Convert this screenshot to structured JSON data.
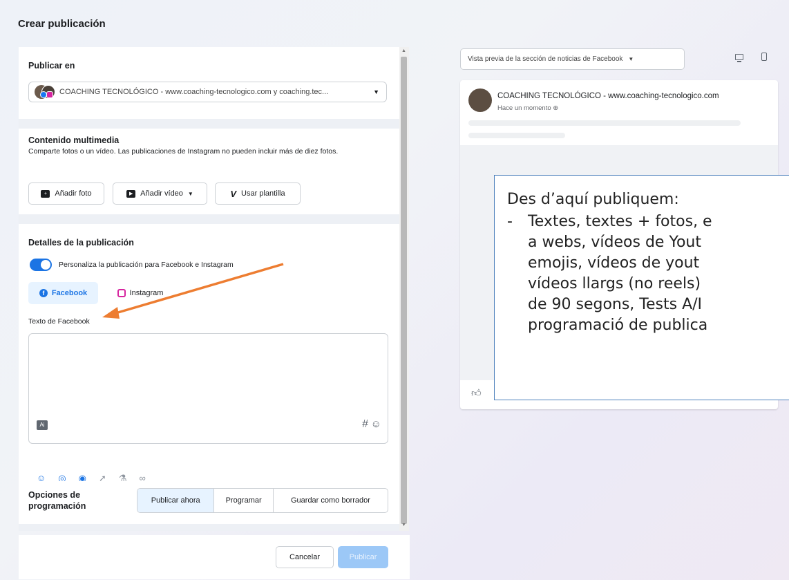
{
  "page": {
    "title": "Crear publicación"
  },
  "publish_in": {
    "title": "Publicar en",
    "selected_page": "COACHING TECNOLÓGICO - www.coaching-tecnologico.com y coaching.tec..."
  },
  "media": {
    "title": "Contenido multimedia",
    "description": "Comparte fotos o un vídeo. Las publicaciones de Instagram no pueden incluir más de diez fotos.",
    "add_photo": "Añadir foto",
    "add_video": "Añadir vídeo",
    "use_template": "Usar plantilla"
  },
  "details": {
    "title": "Detalles de la publicación",
    "toggle_label": "Personaliza la publicación para Facebook e Instagram",
    "toggle_on": true,
    "tabs": [
      {
        "label": "Facebook",
        "active": true
      },
      {
        "label": "Instagram",
        "active": false
      }
    ],
    "text_label": "Texto de Facebook",
    "text_value": "",
    "hash_symbol": "#"
  },
  "scheduling": {
    "title": "Opciones de programación",
    "options": [
      {
        "label": "Publicar ahora",
        "active": true
      },
      {
        "label": "Programar",
        "active": false
      },
      {
        "label": "Guardar como borrador",
        "active": false
      }
    ]
  },
  "footer": {
    "cancel": "Cancelar",
    "publish": "Publicar"
  },
  "preview": {
    "selector": "Vista previa de la sección de noticias de Facebook",
    "page_name": "COACHING TECNOLÓGICO - www.coaching-tecnologico.com",
    "timestamp": "Hace un momento"
  },
  "callout": {
    "line1": "Des d’aquí publiquem:",
    "list_lines": [
      "Textes, textes + fotos, e",
      "a webs, vídeos de Yout",
      "emojis, vídeos de yout",
      "vídeos llargs (no reels)",
      "de 90 segons, Tests A/I",
      "programació de publica"
    ]
  },
  "colors": {
    "accent": "#1b74e4",
    "arrow": "#ed7d31",
    "callout_border": "#4a7ebb"
  }
}
